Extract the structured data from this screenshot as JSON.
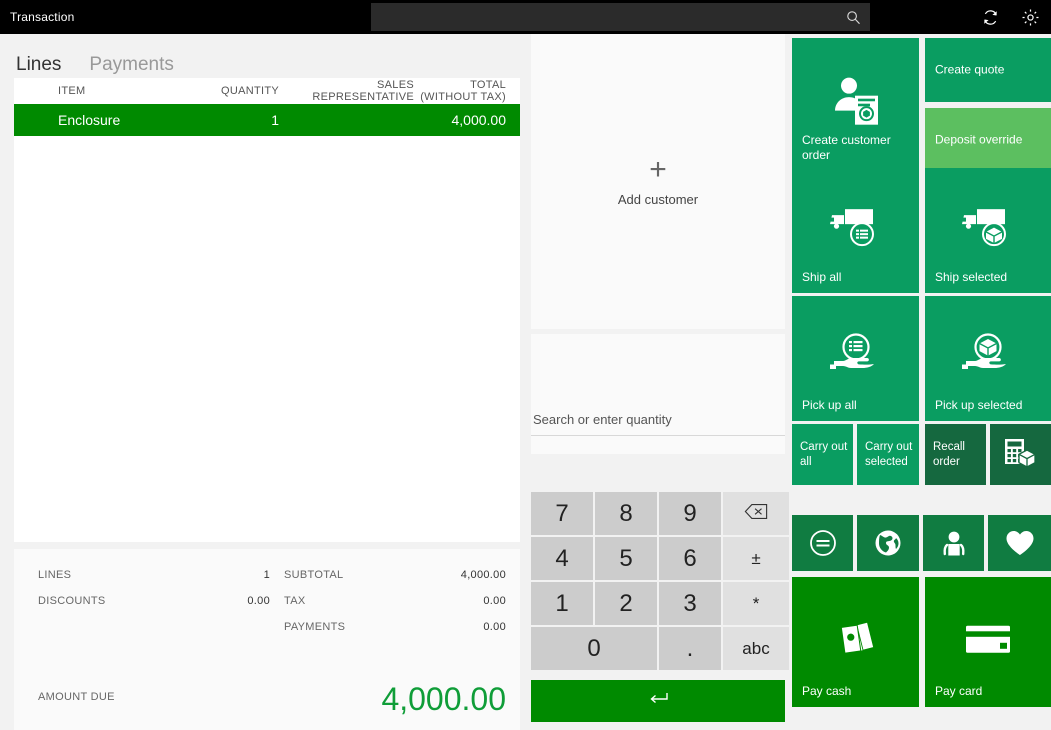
{
  "topbar": {
    "title": "Transaction",
    "search_value": "",
    "search_placeholder": "",
    "search_icon": "search-icon",
    "refresh_icon": "refresh-icon",
    "settings_icon": "gear-icon"
  },
  "left": {
    "tabs": [
      {
        "label": "Lines",
        "active": true
      },
      {
        "label": "Payments",
        "active": false
      }
    ],
    "columns": [
      {
        "label": "ITEM"
      },
      {
        "label": "QUANTITY"
      },
      {
        "label": "SALES REPRESENTATIVE"
      },
      {
        "label": "TOTAL (WITHOUT TAX)"
      }
    ],
    "rows": [
      {
        "item": "Enclosure",
        "quantity": "1",
        "sales_representative": "",
        "total": "4,000.00",
        "selected": true
      }
    ],
    "totals": {
      "lines_label": "LINES",
      "lines_value": "1",
      "discounts_label": "DISCOUNTS",
      "discounts_value": "0.00",
      "subtotal_label": "SUBTOTAL",
      "subtotal_value": "4,000.00",
      "tax_label": "TAX",
      "tax_value": "0.00",
      "payments_label": "PAYMENTS",
      "payments_value": "0.00",
      "amount_due_label": "AMOUNT DUE",
      "amount_due_value": "4,000.00",
      "amount_due_color": "#0f9d38"
    }
  },
  "center": {
    "add_customer_label": "Add customer",
    "add_customer_icon": "plus-icon",
    "quantity_placeholder": "Search or enter quantity",
    "quantity_value": "",
    "numpad": [
      {
        "label": "7",
        "name": "numpad-key-7",
        "type": "digit"
      },
      {
        "label": "8",
        "name": "numpad-key-8",
        "type": "digit"
      },
      {
        "label": "9",
        "name": "numpad-key-9",
        "type": "digit"
      },
      {
        "label": "backspace-icon",
        "name": "numpad-backspace",
        "type": "fn"
      },
      {
        "label": "4",
        "name": "numpad-key-4",
        "type": "digit"
      },
      {
        "label": "5",
        "name": "numpad-key-5",
        "type": "digit"
      },
      {
        "label": "6",
        "name": "numpad-key-6",
        "type": "digit"
      },
      {
        "label": "±",
        "name": "numpad-plus-minus",
        "type": "fn"
      },
      {
        "label": "1",
        "name": "numpad-key-1",
        "type": "digit"
      },
      {
        "label": "2",
        "name": "numpad-key-2",
        "type": "digit"
      },
      {
        "label": "3",
        "name": "numpad-key-3",
        "type": "digit"
      },
      {
        "label": "*",
        "name": "numpad-asterisk",
        "type": "fn"
      },
      {
        "label": "0",
        "name": "numpad-key-0",
        "type": "digit-wide"
      },
      {
        "label": ".",
        "name": "numpad-decimal",
        "type": "digit"
      },
      {
        "label": "abc",
        "name": "numpad-abc",
        "type": "fn"
      }
    ],
    "enter_icon": "enter-icon"
  },
  "tiles": {
    "create_customer_order": {
      "label": "Create customer order",
      "icon": "customer-order-icon",
      "color": "#0A9D61"
    },
    "create_quote": {
      "label": "Create quote",
      "icon": "",
      "color": "#0A9D61"
    },
    "deposit_override": {
      "label": "Deposit override",
      "icon": "",
      "color": "#5CBF60"
    },
    "ship_all": {
      "label": "Ship all",
      "icon": "truck-list-icon",
      "color": "#0A9D61"
    },
    "ship_selected": {
      "label": "Ship selected",
      "icon": "truck-box-icon",
      "color": "#0A9D61"
    },
    "pick_up_all": {
      "label": "Pick up all",
      "icon": "hand-list-icon",
      "color": "#0A9D61"
    },
    "pick_up_selected": {
      "label": "Pick up selected",
      "icon": "hand-box-icon",
      "color": "#0A9D61"
    },
    "carry_out_all": {
      "label": "Carry out all",
      "icon": "",
      "color": "#0A9D61"
    },
    "carry_out_selected": {
      "label": "Carry out selected",
      "icon": "",
      "color": "#0A9D61"
    },
    "recall_order": {
      "label": "Recall order",
      "icon": "",
      "color": "#15683F"
    },
    "inventory_lookup": {
      "label": "",
      "icon": "calculator-box-icon",
      "color": "#15683F"
    },
    "price_check": {
      "label": "",
      "icon": "equals-circle-icon",
      "color": "#107C41"
    },
    "globe": {
      "label": "",
      "icon": "globe-icon",
      "color": "#107C41"
    },
    "customer": {
      "label": "",
      "icon": "person-icon",
      "color": "#107C41"
    },
    "loyalty": {
      "label": "",
      "icon": "heart-icon",
      "color": "#107C41"
    },
    "pay_cash": {
      "label": "Pay cash",
      "icon": "cash-icon",
      "color": "#008A00"
    },
    "pay_card": {
      "label": "Pay card",
      "icon": "card-icon",
      "color": "#008A00"
    }
  }
}
